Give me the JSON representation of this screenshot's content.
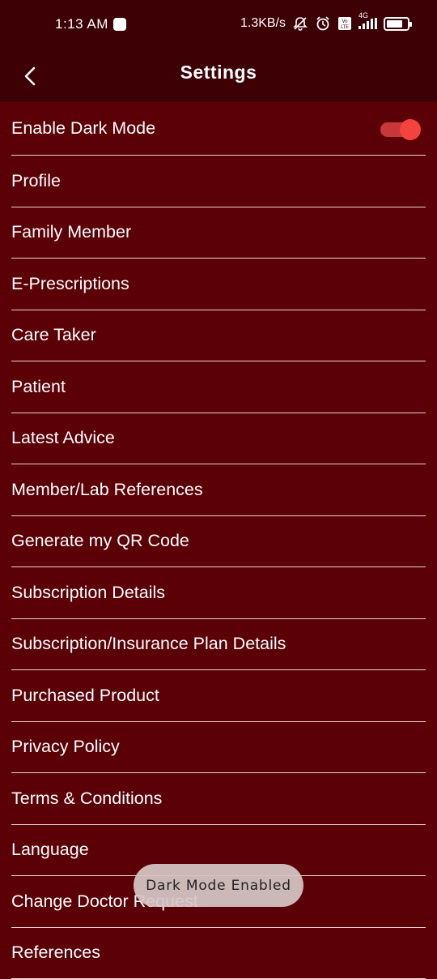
{
  "status_bar": {
    "time": "1:13 AM",
    "net_speed": "1.3KB/s",
    "network_type": "4G",
    "volte_label": "Vo LTE",
    "icons": [
      "notification-icon",
      "mute-icon",
      "alarm-icon",
      "volte-icon",
      "signal-icon",
      "battery-icon"
    ],
    "battery_level": 0.8
  },
  "app_bar": {
    "title": "Settings",
    "back_icon": "chevron-left-icon"
  },
  "settings": {
    "dark_mode": {
      "label": "Enable Dark Mode",
      "enabled": true
    },
    "items": [
      "Profile",
      "Family Member",
      "E-Prescriptions",
      "Care Taker",
      "Patient",
      "Latest Advice",
      "Member/Lab References",
      "Generate my QR Code",
      "Subscription Details",
      "Subscription/Insurance Plan Details",
      "Purchased Product",
      "Privacy Policy",
      "Terms & Conditions",
      "Language",
      "Change Doctor Request",
      "References"
    ]
  },
  "toast": {
    "text": "Dark Mode Enabled"
  },
  "colors": {
    "background": "#5a0006",
    "app_bar": "#3d0004",
    "toggle_on": "#f4433c",
    "divider": "#e8d6d6"
  }
}
